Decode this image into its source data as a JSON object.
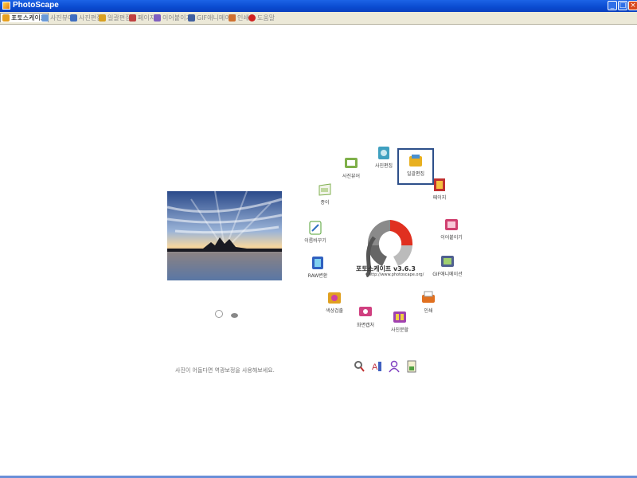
{
  "window": {
    "title": "PhotoScape",
    "min": "_",
    "max": "□",
    "close": "×"
  },
  "tabs": [
    {
      "label": "포토스케이프",
      "icon": "home-icon",
      "color": "#e6a020"
    },
    {
      "label": "사진뷰어",
      "icon": "viewer-icon",
      "color": "#6a9ad8"
    },
    {
      "label": "사진편집",
      "icon": "editor-icon",
      "color": "#3f6ec0"
    },
    {
      "label": "일괄편집",
      "icon": "batch-icon",
      "color": "#d8a020"
    },
    {
      "label": "페이지",
      "icon": "page-icon",
      "color": "#c04040"
    },
    {
      "label": "이어붙이기",
      "icon": "combine-icon",
      "color": "#8060c0"
    },
    {
      "label": "GIF애니메이션",
      "icon": "gif-icon",
      "color": "#4060a0"
    },
    {
      "label": "인쇄",
      "icon": "print-icon",
      "color": "#d07030"
    },
    {
      "label": "도움말",
      "icon": "help-icon",
      "color": "#d02020"
    }
  ],
  "menu": [
    {
      "label": "사진뷰어",
      "icon": "viewer-icon",
      "color": "#7fb04a"
    },
    {
      "label": "사진편집",
      "icon": "editor-icon",
      "color": "#3fa0c0"
    },
    {
      "label": "일괄편집",
      "icon": "batch-icon",
      "color": "#e8b020"
    },
    {
      "label": "페이지",
      "icon": "page-icon",
      "color": "#c03030"
    },
    {
      "label": "이어붙이기",
      "icon": "combine-icon",
      "color": "#d04070"
    },
    {
      "label": "GIF애니메이션",
      "icon": "gif-icon",
      "color": "#506090"
    },
    {
      "label": "인쇄",
      "icon": "print-icon",
      "color": "#e07020"
    },
    {
      "label": "사진분할",
      "icon": "splitter-icon",
      "color": "#a040b0"
    },
    {
      "label": "화면캡처",
      "icon": "screen-capture-icon",
      "color": "#d04080"
    },
    {
      "label": "색상검출",
      "icon": "color-picker-icon",
      "color": "#e0a020"
    },
    {
      "label": "RAW변환",
      "icon": "raw-converter-icon",
      "color": "#3060c0"
    },
    {
      "label": "이름바꾸기",
      "icon": "rename-icon",
      "color": "#50a030"
    },
    {
      "label": "종이",
      "icon": "paper-icon",
      "color": "#80b050"
    }
  ],
  "logo": {
    "name": "포토스케이프 v3.6.3",
    "url": "http://www.photoscape.org/"
  },
  "hint": "사진이 어둡다면 역광보정을 사용해보세요.",
  "colors": {
    "accent": "#2d4f8a",
    "titlebar": "#0a4bd0",
    "logo_red": "#e03020",
    "logo_gray": "#666666"
  }
}
